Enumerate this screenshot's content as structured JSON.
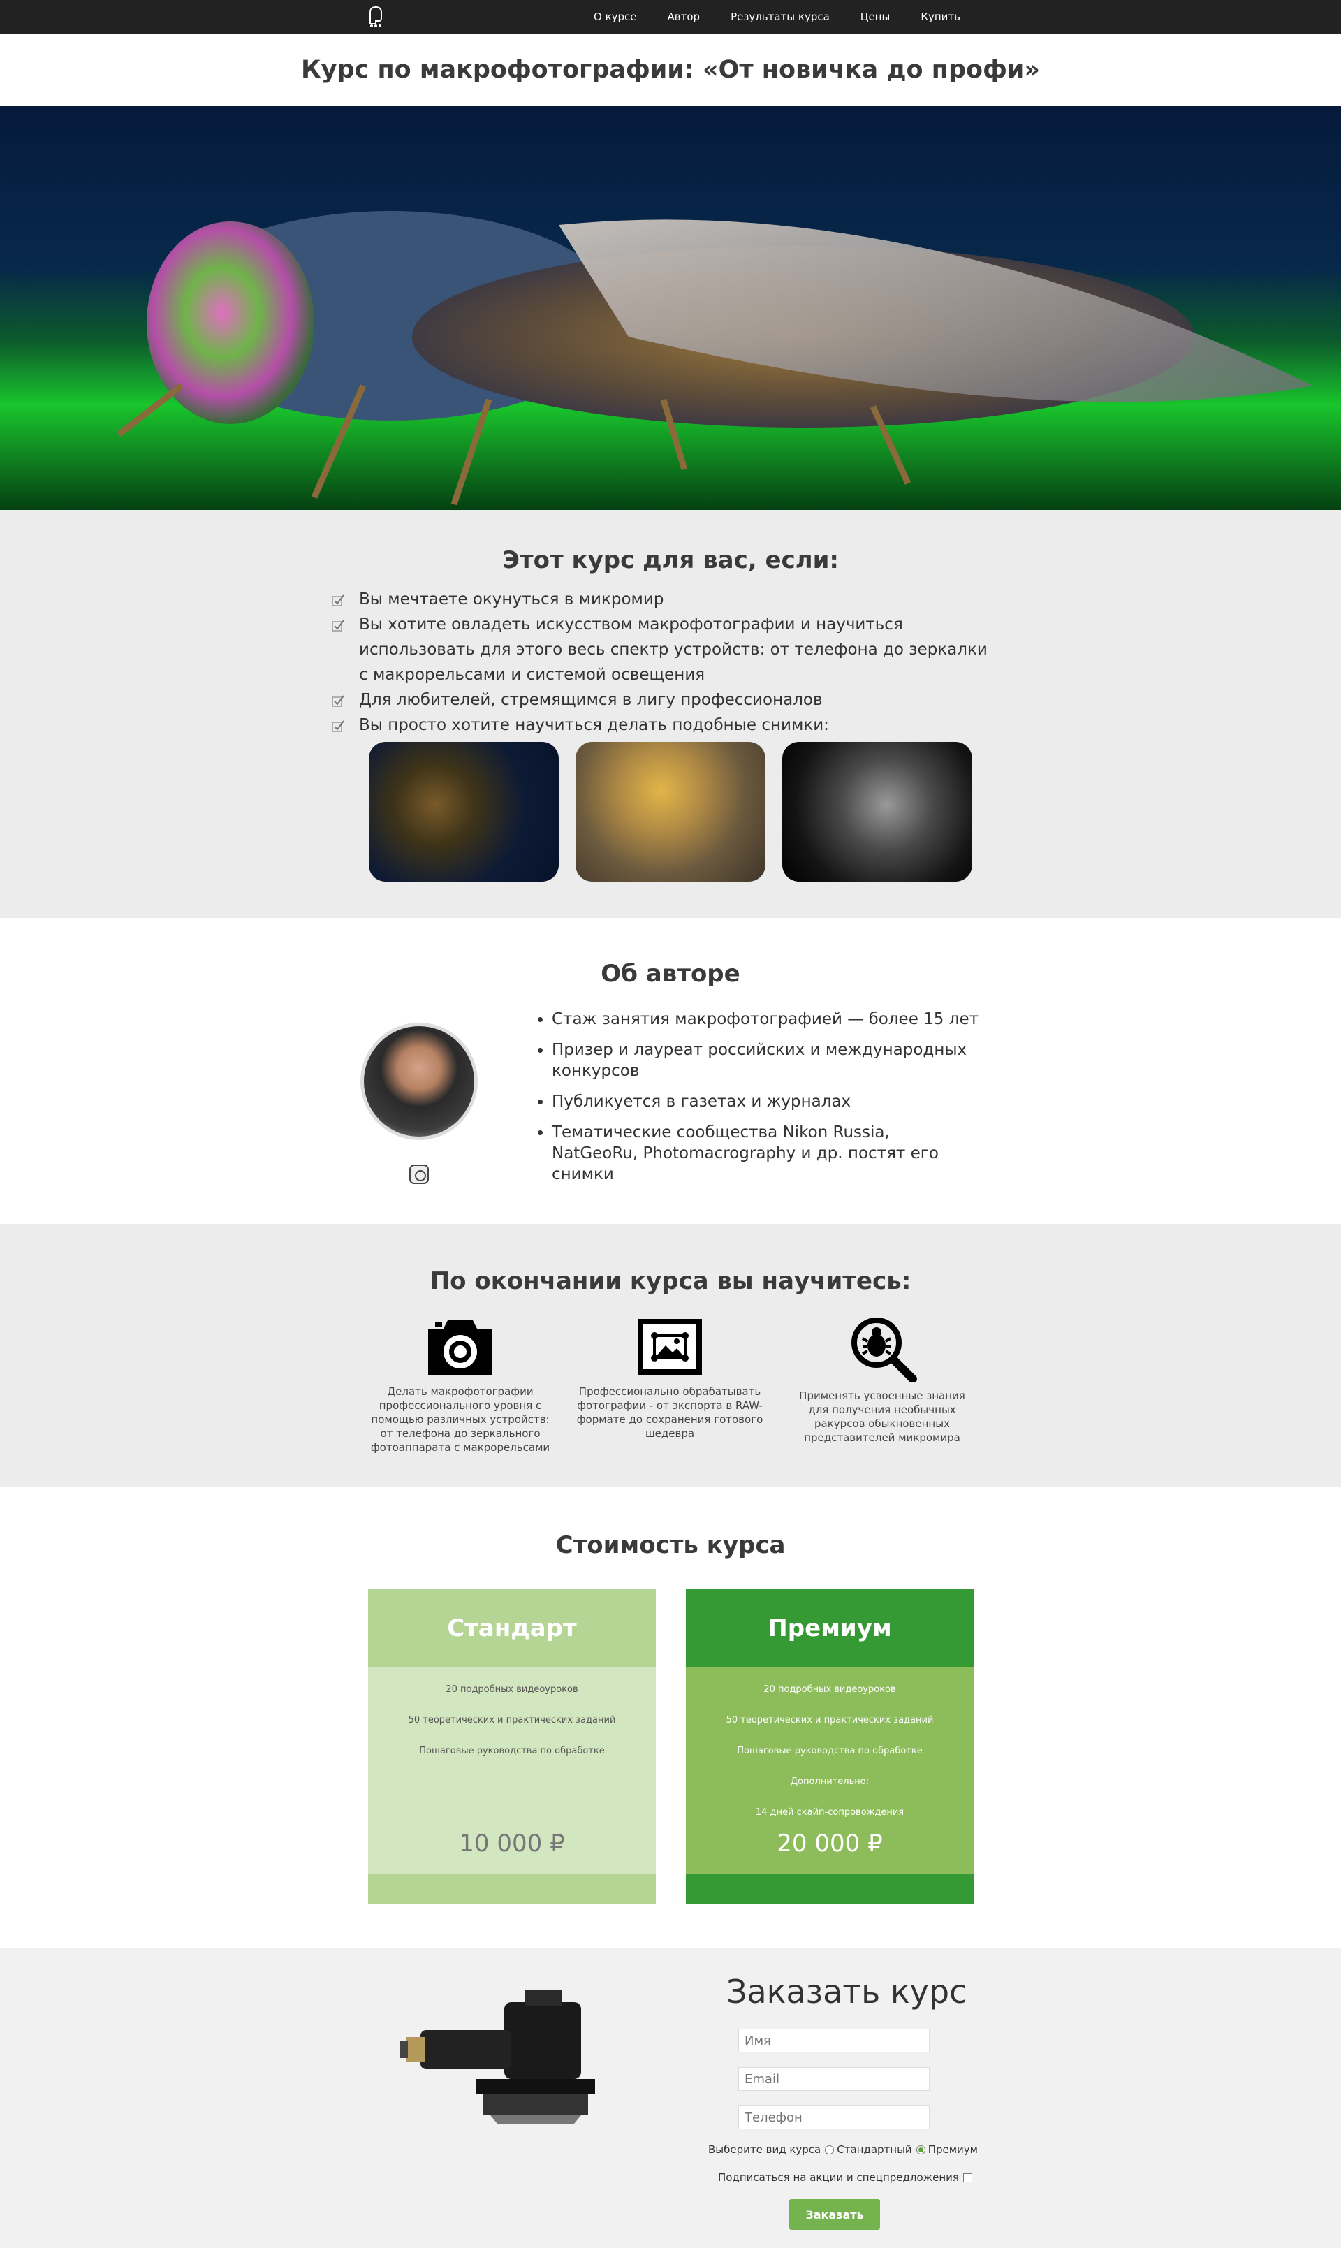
{
  "nav": {
    "items": [
      "О курсе",
      "Автор",
      "Результаты курса",
      "Цены",
      "Купить"
    ]
  },
  "page_title": "Курс по макрофотографии: «От новичка до профи»",
  "for_you": {
    "title": "Этот курс для вас, если:",
    "items": [
      "Вы мечтаете окунуться в микромир",
      "Вы хотите овладеть искусством макрофотографии и научиться использовать для этого весь спектр устройств: от телефона до зеркалки с макрорельсами и системой освещения",
      "Для любителей, стремящимся в лигу профессионалов",
      "Вы просто хотите научиться делать подобные снимки:"
    ]
  },
  "author": {
    "title": "Об авторе",
    "items": [
      "Стаж занятия макрофотографией — более 15 лет",
      "Призер и лауреат российских и международных конкурсов",
      "Публикуется в газетах и журналах",
      "Тематические сообщества Nikon Russia, NatGeoRu, Photomacrography и др. постят его снимки"
    ]
  },
  "learn": {
    "title": "По окончании курса вы научитесь:",
    "skills": [
      {
        "icon": "camera-icon",
        "text": "Делать макрофотографии профессионального уровня с помощью различных устройств: от телефона до зеркального фотоаппарата с макрорельсами"
      },
      {
        "icon": "picture-frame-icon",
        "text": "Профессионально обрабатывать фотографии - от экспорта в RAW-формате до сохранения готового шедевра"
      },
      {
        "icon": "bug-magnifier-icon",
        "text": "Применять усвоенные знания для получения необычных ракурсов обыкновенных представителей микромира"
      }
    ]
  },
  "pricing": {
    "title": "Стоимость курса",
    "standard": {
      "name": "Стандарт",
      "features": [
        "20 подробных видеоуроков",
        "50 теоретических и практических заданий",
        "Пошаговые руководства по обработке"
      ],
      "price": "10 000 ₽"
    },
    "premium": {
      "name": "Премиум",
      "features": [
        "20 подробных видеоуроков",
        "50 теоретических и практических заданий",
        "Пошаговые руководства по обработке",
        "Дополнительно:",
        "14 дней скайп-сопровождения"
      ],
      "price": "20 000 ₽"
    }
  },
  "order": {
    "title": "Заказать курс",
    "name_placeholder": "Имя",
    "email_placeholder": "Email",
    "phone_placeholder": "Телефон",
    "choose_label": "Выберите вид курса",
    "option_standard": "Стандартный",
    "option_premium": "Премиум",
    "selected": "Премиум",
    "subscribe_label": "Подписаться на акции и спецпредложения",
    "submit_label": "Заказать"
  },
  "colors": {
    "nav_bg": "#222222",
    "section_gray": "#ececec",
    "standard_head": "#b4d594",
    "standard_body": "#d2e6bf",
    "premium_head": "#369a34",
    "premium_body": "#8cbd5a",
    "submit": "#74b34d"
  }
}
